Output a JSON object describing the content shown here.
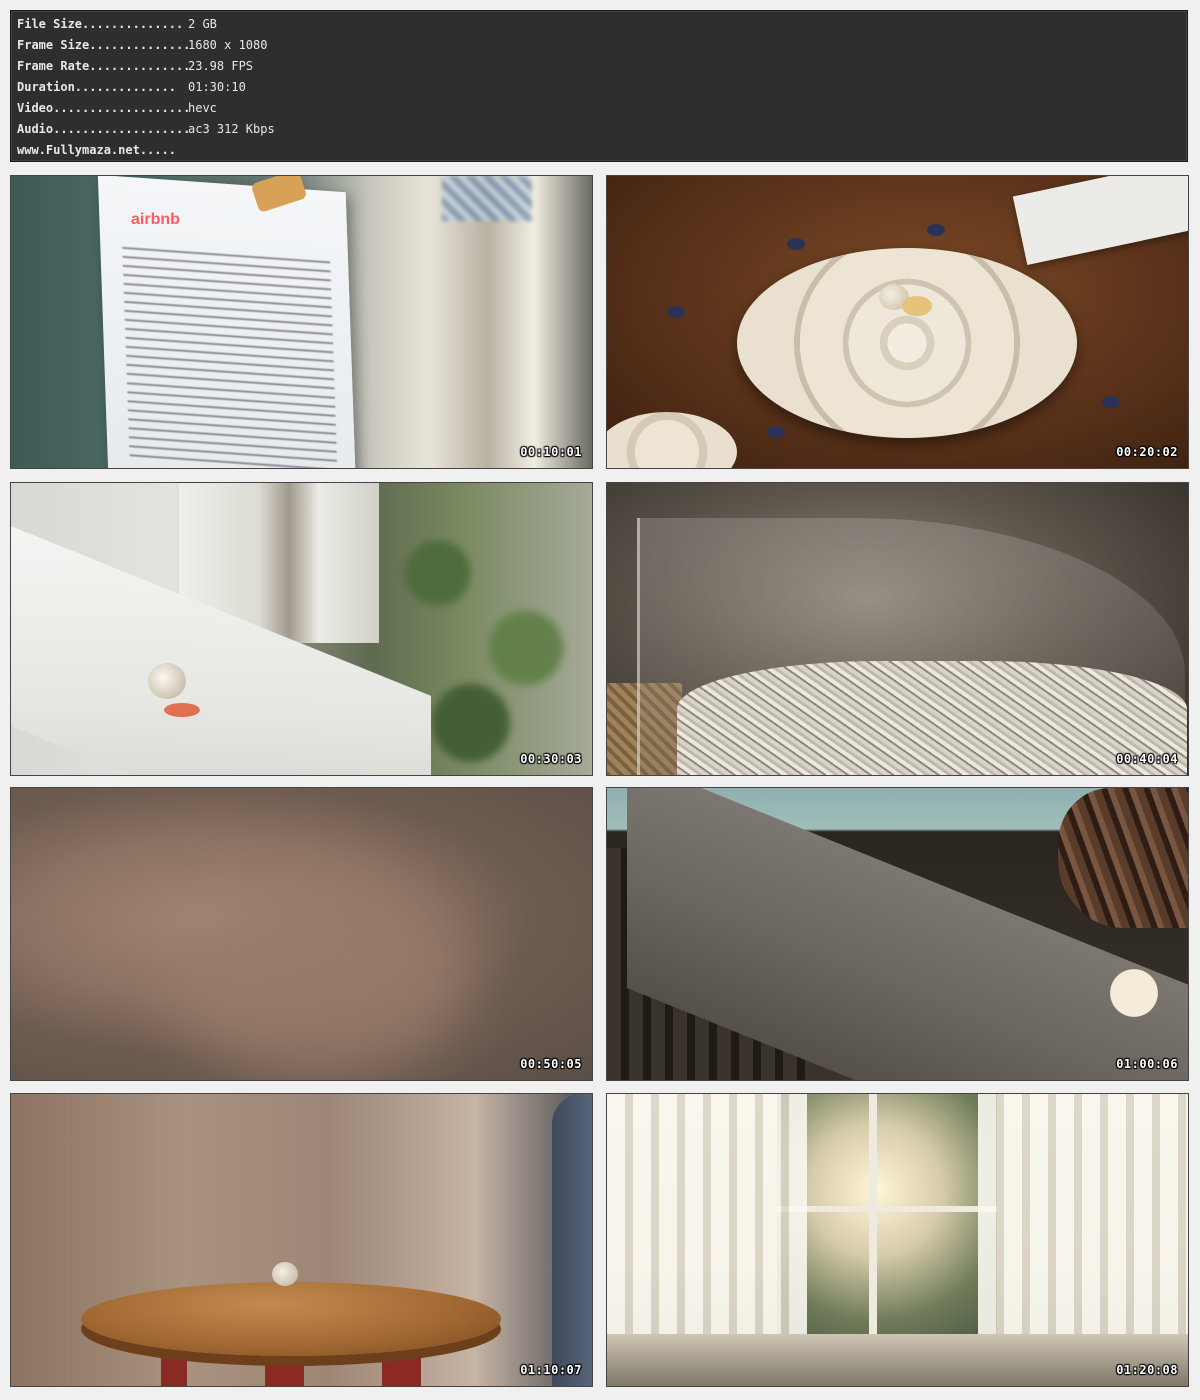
{
  "info": {
    "rows": [
      {
        "label": "File Size..............",
        "value": "2 GB"
      },
      {
        "label": "Frame Size..............",
        "value": "1680 x 1080"
      },
      {
        "label": "Frame Rate..............",
        "value": "23.98 FPS"
      },
      {
        "label": "Duration..............",
        "value": "01:30:10"
      },
      {
        "label": "Video....................",
        "value": "hevc"
      },
      {
        "label": "Audio....................",
        "value": "ac3 312 Kbps"
      }
    ],
    "site": "www.Fullymaza.net....."
  },
  "thumbnails": [
    {
      "timestamp": "00:10:01",
      "sign_text": "airbnb"
    },
    {
      "timestamp": "00:20:02"
    },
    {
      "timestamp": "00:30:03"
    },
    {
      "timestamp": "00:40:04"
    },
    {
      "timestamp": "00:50:05"
    },
    {
      "timestamp": "01:00:06"
    },
    {
      "timestamp": "01:10:07"
    },
    {
      "timestamp": "01:20:08"
    }
  ]
}
